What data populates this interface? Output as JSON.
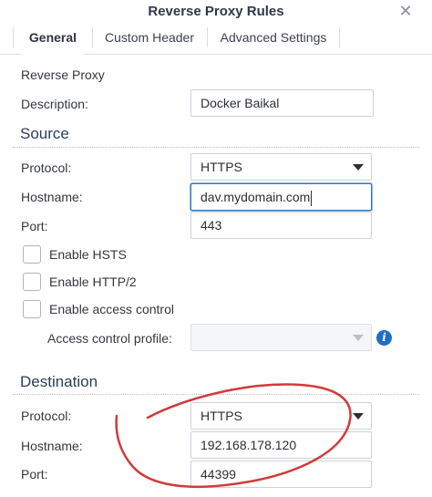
{
  "window": {
    "title": "Reverse Proxy Rules",
    "close_glyph": "✕"
  },
  "tabs": [
    {
      "label": "General",
      "active": true
    },
    {
      "label": "Custom Header",
      "active": false
    },
    {
      "label": "Advanced Settings",
      "active": false
    }
  ],
  "general": {
    "heading": "Reverse Proxy",
    "description_label": "Description:",
    "description_value": "Docker Baikal"
  },
  "source": {
    "title": "Source",
    "protocol_label": "Protocol:",
    "protocol_value": "HTTPS",
    "hostname_label": "Hostname:",
    "hostname_value": "dav.mydomain.com",
    "port_label": "Port:",
    "port_value": "443",
    "hsts_label": "Enable HSTS",
    "hsts_checked": false,
    "http2_label": "Enable HTTP/2",
    "http2_checked": false,
    "access_control_label": "Enable access control",
    "access_control_checked": false,
    "access_profile_label": "Access control profile:",
    "access_profile_value": ""
  },
  "destination": {
    "title": "Destination",
    "protocol_label": "Protocol:",
    "protocol_value": "HTTPS",
    "hostname_label": "Hostname:",
    "hostname_value": "192.168.178.120",
    "port_label": "Port:",
    "port_value": "44399"
  },
  "icons": {
    "info": "i",
    "dropdown": "chevron-down-icon"
  },
  "colors": {
    "section_title": "#2c3e57",
    "focus_border": "#2f78c4",
    "info_icon": "#1f6fc4",
    "annotation": "#d13a3a"
  }
}
